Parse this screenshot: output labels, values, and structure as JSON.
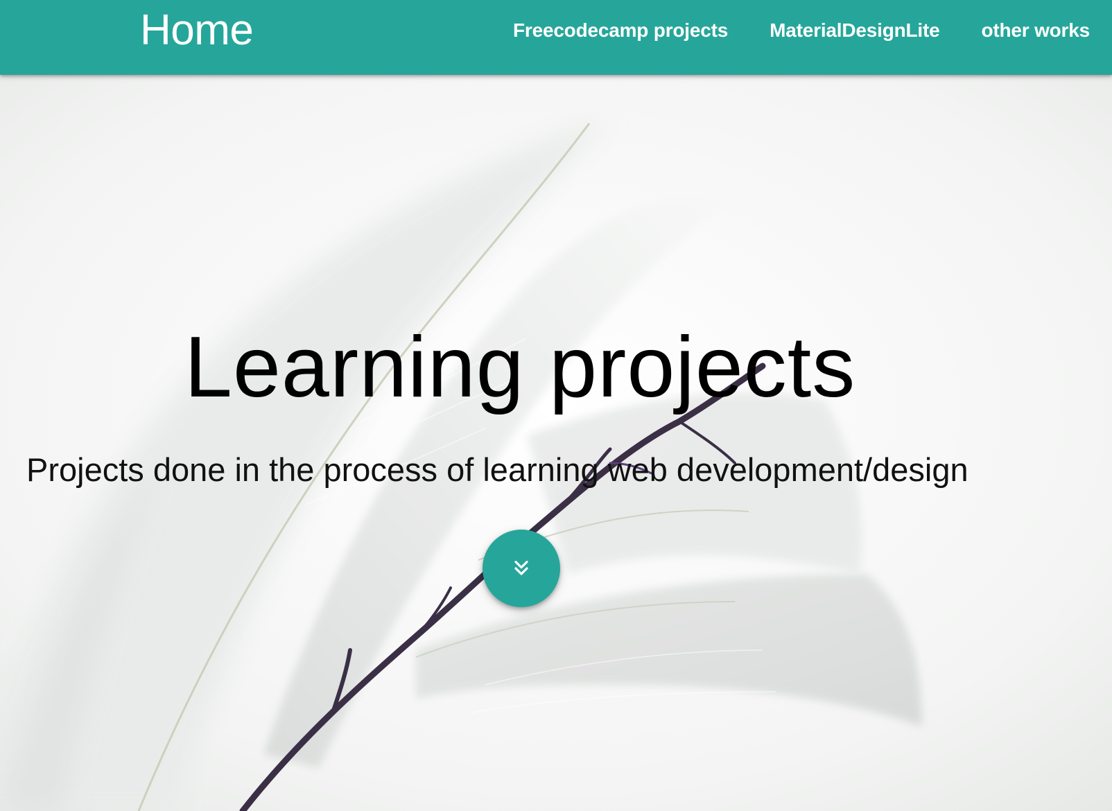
{
  "header": {
    "brand": "Home",
    "nav": [
      {
        "label": "Freecodecamp projects"
      },
      {
        "label": "MaterialDesignLite"
      },
      {
        "label": "other works"
      }
    ]
  },
  "hero": {
    "title": "Learning projects",
    "subtitle": "Projects done in the process of learning web development/design",
    "scroll_button_icon": "double-chevron-down-icon"
  },
  "colors": {
    "accent": "#26a69a",
    "text": "#000000"
  }
}
